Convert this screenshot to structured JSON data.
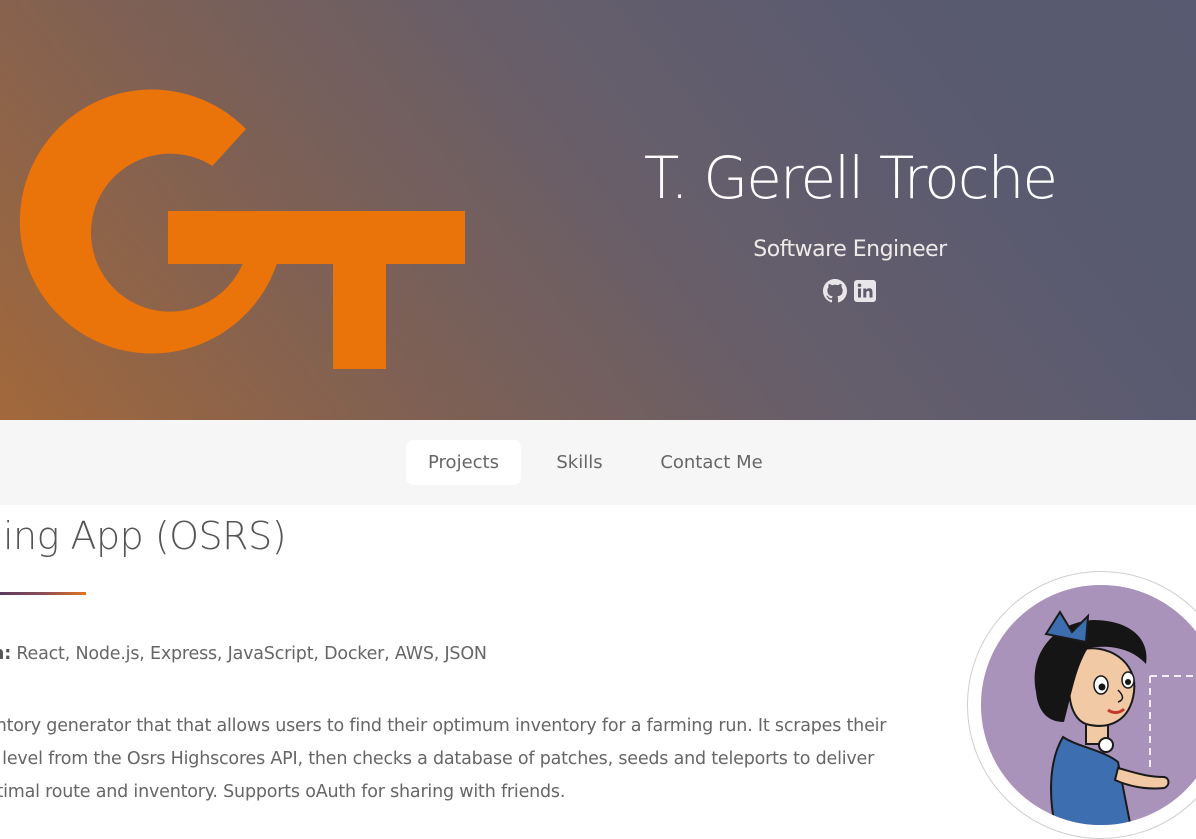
{
  "hero": {
    "name": "T. Gerell Troche",
    "role": "Software Engineer",
    "logo": "GT-monogram-logo",
    "accent_color": "#ea730a",
    "social": [
      {
        "icon": "github-icon"
      },
      {
        "icon": "linkedin-icon"
      }
    ]
  },
  "nav": {
    "tabs": [
      {
        "label": "Projects",
        "active": true
      },
      {
        "label": "Skills",
        "active": false
      },
      {
        "label": "Contact Me",
        "active": false
      }
    ]
  },
  "project": {
    "title": "rming App (OSRS)",
    "built_with_label": "with:",
    "built_with": "React, Node.js, Express, JavaScript, Docker, AWS, JSON",
    "description_lines": [
      "ventory generator that that allows users to find their optimum inventory for a farming run. It scrapes their",
      "ng level from the Osrs Highscores API, then checks a database of patches, seeds and teleports to deliver",
      "optimal route and inventory. Supports oAuth for sharing with friends."
    ],
    "image": "cartoon-character-thumbnail"
  }
}
